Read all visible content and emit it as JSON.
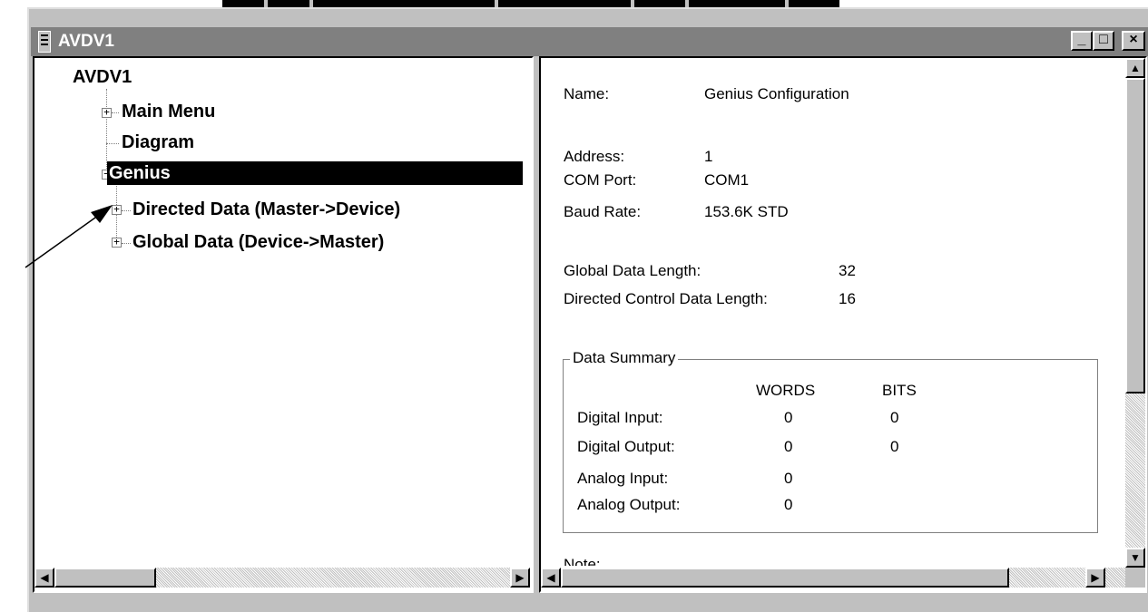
{
  "window": {
    "title": "AVDV1"
  },
  "title_buttons": {
    "minimize": "_",
    "maximize": "□",
    "close": "×"
  },
  "tree": {
    "root": "AVDV1",
    "items": [
      {
        "label": "Main Menu",
        "expander": "+"
      },
      {
        "label": "Diagram"
      },
      {
        "label": "Genius",
        "expander": "−",
        "selected": true
      },
      {
        "label": "Directed Data (Master->Device)",
        "expander": "+"
      },
      {
        "label": "Global Data (Device->Master)",
        "expander": "+"
      }
    ]
  },
  "details": {
    "name_label": "Name:",
    "name_value": "Genius Configuration",
    "address_label": "Address:",
    "address_value": "1",
    "com_label": "COM Port:",
    "com_value": "COM1",
    "baud_label": "Baud Rate:",
    "baud_value": "153.6K STD",
    "global_len_label": "Global Data Length:",
    "global_len_value": "32",
    "directed_len_label": "Directed Control Data Length:",
    "directed_len_value": "16",
    "note_label": "Note:"
  },
  "summary": {
    "title": "Data Summary",
    "col_words": "WORDS",
    "col_bits": "BITS",
    "rows": [
      {
        "label": "Digital Input:",
        "words": "0",
        "bits": "0"
      },
      {
        "label": "Digital Output:",
        "words": "0",
        "bits": "0"
      },
      {
        "label": "Analog Input:",
        "words": "0",
        "bits": ""
      },
      {
        "label": "Analog Output:",
        "words": "0",
        "bits": ""
      }
    ]
  },
  "scroll_glyphs": {
    "up": "▲",
    "down": "▼",
    "left": "◀",
    "right": "▶"
  }
}
